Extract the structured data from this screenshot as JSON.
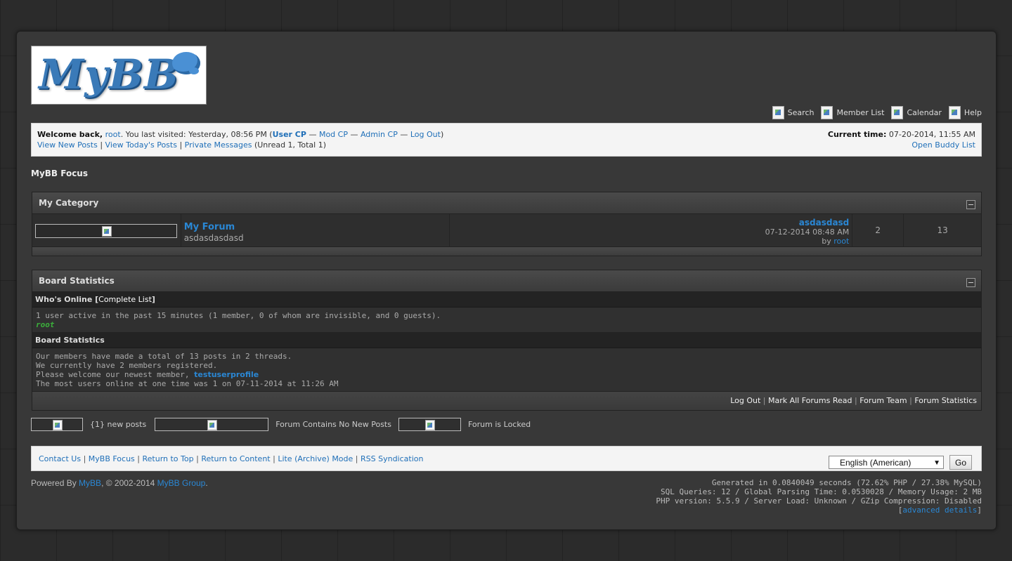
{
  "logo": {
    "text": "MyBB"
  },
  "menu": [
    {
      "label": "Search",
      "icon": "search-icon"
    },
    {
      "label": "Member List",
      "icon": "member-list-icon"
    },
    {
      "label": "Calendar",
      "icon": "calendar-icon"
    },
    {
      "label": "Help",
      "icon": "help-icon"
    }
  ],
  "welcome": {
    "greeting": "Welcome back,",
    "username": "root",
    "last_visit": ". You last visited: Yesterday, 08:56 PM (",
    "user_cp": "User CP",
    "mod_cp": "Mod CP",
    "admin_cp": "Admin CP",
    "logout": "Log Out",
    "sep": " — ",
    "close_paren": ")",
    "view_new_posts": "View New Posts",
    "view_todays_posts": "View Today's Posts",
    "private_messages": "Private Messages",
    "pm_counts": "(Unread 1, Total 1)",
    "current_time_label": "Current time:",
    "current_time": "07-20-2014, 11:55 AM",
    "buddy_list": "Open Buddy List"
  },
  "breadcrumb": "MyBB Focus",
  "category": {
    "title": "My Category",
    "forums": [
      {
        "name": "My Forum",
        "description": "asdasdasdasd",
        "lastpost_title": "asdasdasd",
        "lastpost_date": "07-12-2014 08:48 AM",
        "lastpost_by": "by",
        "lastpost_user": "root",
        "threads": "2",
        "posts": "13"
      }
    ]
  },
  "stats": {
    "title": "Board Statistics",
    "whos_online": "Who's Online",
    "complete_list": "Complete List",
    "online_text": "1 user active in the past 15 minutes (1 member, 0 of whom are invisible, and 0 guests).",
    "online_user": "root",
    "board_stats_head": "Board Statistics",
    "line1": "Our members have made a total of 13 posts in 2 threads.",
    "line2": "We currently have 2 members registered.",
    "line3": "Please welcome our newest member,",
    "newest_member": "testuserprofile",
    "line4": "The most users online at one time was 1 on 07-11-2014 at 11:26 AM"
  },
  "bottom_links": [
    "Log Out",
    "Mark All Forums Read",
    "Forum Team",
    "Forum Statistics"
  ],
  "legend": [
    {
      "label": "{1} new posts"
    },
    {
      "label": "Forum Contains No New Posts"
    },
    {
      "label": "Forum is Locked"
    }
  ],
  "footer": {
    "links": [
      "Contact Us",
      "MyBB Focus",
      "Return to Top",
      "Return to Content",
      "Lite (Archive) Mode",
      "RSS Syndication"
    ],
    "language": "English (American)",
    "go": "Go"
  },
  "powered": {
    "prefix": "Powered By",
    "mybb": "MyBB",
    "copyright": ", © 2002-2014",
    "group": "MyBB Group",
    "dot": "."
  },
  "debug": {
    "line1": "Generated in 0.0840049 seconds (72.62% PHP / 27.38% MySQL)",
    "line2": "SQL Queries: 12 / Global Parsing Time: 0.0530028 / Memory Usage: 2 MB",
    "line3": "PHP version: 5.5.9 / Server Load: Unknown / GZip Compression: Disabled",
    "advanced": "advanced details"
  }
}
